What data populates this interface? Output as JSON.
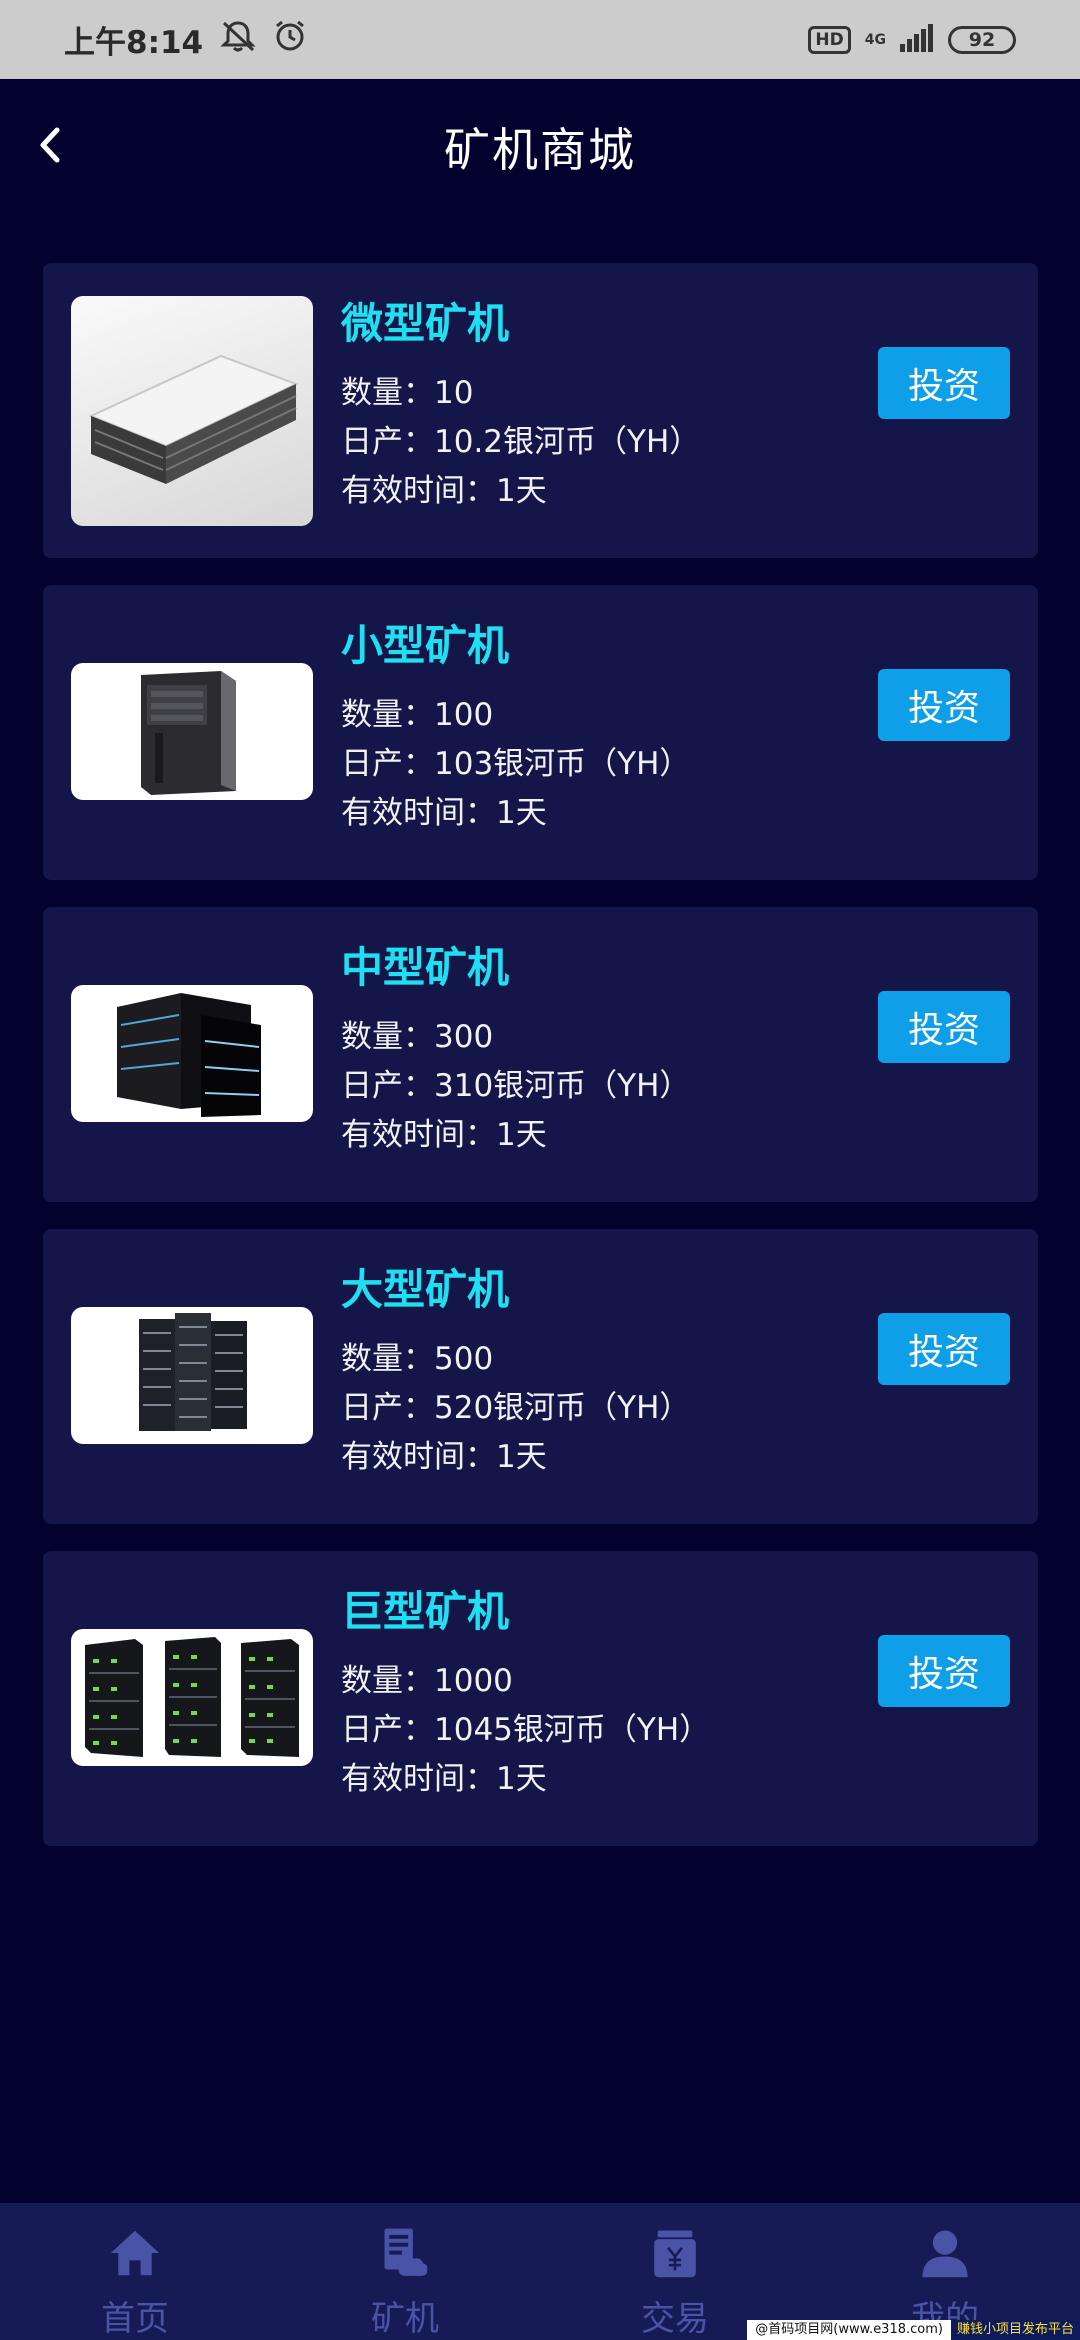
{
  "status_bar": {
    "time": "上午8:14",
    "hd": "HD",
    "network": "4G",
    "battery": "92"
  },
  "header": {
    "title": "矿机商城"
  },
  "products": [
    {
      "name": "微型矿机",
      "quantity": "数量：10",
      "daily_output": "日产：10.2银河币（YH）",
      "valid_time": "有效时间：1天",
      "action": "投资"
    },
    {
      "name": "小型矿机",
      "quantity": "数量：100",
      "daily_output": "日产：103银河币（YH）",
      "valid_time": "有效时间：1天",
      "action": "投资"
    },
    {
      "name": "中型矿机",
      "quantity": "数量：300",
      "daily_output": "日产：310银河币（YH）",
      "valid_time": "有效时间：1天",
      "action": "投资"
    },
    {
      "name": "大型矿机",
      "quantity": "数量：500",
      "daily_output": "日产：520银河币（YH）",
      "valid_time": "有效时间：1天",
      "action": "投资"
    },
    {
      "name": "巨型矿机",
      "quantity": "数量：1000",
      "daily_output": "日产：1045银河币（YH）",
      "valid_time": "有效时间：1天",
      "action": "投资"
    }
  ],
  "tabbar": [
    {
      "label": "首页",
      "icon": "home-icon"
    },
    {
      "label": "矿机",
      "icon": "miner-icon"
    },
    {
      "label": "交易",
      "icon": "trade-icon"
    },
    {
      "label": "我的",
      "icon": "profile-icon"
    }
  ],
  "watermark": {
    "left": "@首码项目网(www.e318.com)",
    "right": "赚钱小项目发布平台"
  },
  "colors": {
    "background": "#03022f",
    "card": "#14164a",
    "accent_cyan": "#1ee0f0",
    "button_blue": "#0e9fe8",
    "tab_inactive": "#4a54a6"
  }
}
